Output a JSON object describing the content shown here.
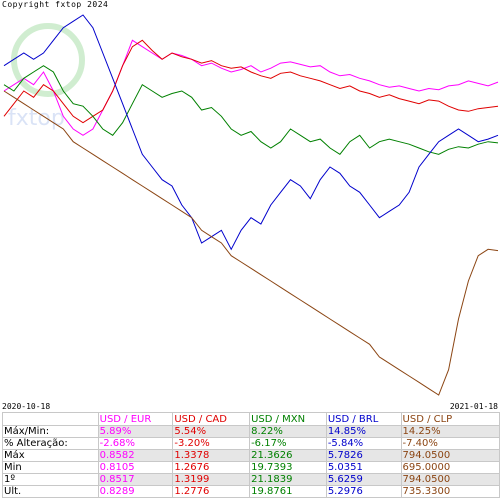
{
  "copyright": "Copyright fxtop 2024",
  "watermark": "fxtop",
  "chart_data": {
    "type": "line",
    "x_start_label": "2020-10-18",
    "x_end_label": "2021-01-18",
    "series": [
      {
        "name": "USD / EUR",
        "color": "#ff00ff",
        "values": [
          0.6,
          0.55,
          0.5,
          0.55,
          0.45,
          0.6,
          0.8,
          0.9,
          0.95,
          0.9,
          0.75,
          0.6,
          0.4,
          0.2,
          0.25,
          0.3,
          0.35,
          0.3,
          0.32,
          0.35,
          0.4,
          0.38,
          0.42,
          0.45,
          0.43,
          0.4,
          0.45,
          0.42,
          0.38,
          0.37,
          0.39,
          0.41,
          0.4,
          0.45,
          0.48,
          0.47,
          0.5,
          0.52,
          0.55,
          0.57,
          0.56,
          0.58,
          0.6,
          0.58,
          0.59,
          0.56,
          0.55,
          0.52,
          0.54,
          0.56,
          0.53
        ]
      },
      {
        "name": "USD / CAD",
        "color": "#e00000",
        "values": [
          0.8,
          0.7,
          0.6,
          0.65,
          0.55,
          0.6,
          0.7,
          0.8,
          0.85,
          0.8,
          0.75,
          0.6,
          0.4,
          0.25,
          0.2,
          0.28,
          0.35,
          0.3,
          0.33,
          0.35,
          0.38,
          0.36,
          0.4,
          0.42,
          0.41,
          0.45,
          0.48,
          0.5,
          0.46,
          0.45,
          0.48,
          0.5,
          0.52,
          0.55,
          0.58,
          0.56,
          0.6,
          0.62,
          0.65,
          0.63,
          0.66,
          0.68,
          0.7,
          0.67,
          0.68,
          0.72,
          0.75,
          0.76,
          0.74,
          0.73,
          0.72
        ]
      },
      {
        "name": "USD / MXN",
        "color": "#008000",
        "values": [
          0.55,
          0.6,
          0.5,
          0.45,
          0.4,
          0.45,
          0.6,
          0.7,
          0.72,
          0.8,
          0.9,
          0.95,
          0.85,
          0.7,
          0.55,
          0.6,
          0.65,
          0.62,
          0.6,
          0.65,
          0.75,
          0.73,
          0.8,
          0.9,
          0.95,
          0.92,
          1.0,
          1.05,
          1.0,
          0.9,
          0.95,
          1.0,
          0.98,
          1.05,
          1.1,
          1.0,
          0.95,
          1.05,
          1.0,
          0.98,
          1.0,
          1.02,
          1.05,
          1.08,
          1.1,
          1.06,
          1.04,
          1.05,
          1.02,
          1.0,
          1.01
        ]
      },
      {
        "name": "USD / BRL",
        "color": "#0000cc",
        "values": [
          0.4,
          0.35,
          0.3,
          0.35,
          0.3,
          0.2,
          0.1,
          0.05,
          0.0,
          0.1,
          0.3,
          0.5,
          0.7,
          0.9,
          1.1,
          1.2,
          1.3,
          1.35,
          1.5,
          1.6,
          1.8,
          1.75,
          1.7,
          1.85,
          1.7,
          1.6,
          1.65,
          1.5,
          1.4,
          1.3,
          1.35,
          1.45,
          1.3,
          1.2,
          1.25,
          1.35,
          1.4,
          1.5,
          1.6,
          1.55,
          1.5,
          1.4,
          1.2,
          1.1,
          1.0,
          0.95,
          0.9,
          0.95,
          1.0,
          0.98,
          0.95
        ]
      },
      {
        "name": "USD / CLP",
        "color": "#8b4513",
        "values": [
          0.6,
          0.65,
          0.7,
          0.75,
          0.8,
          0.85,
          0.9,
          1.0,
          1.05,
          1.1,
          1.15,
          1.2,
          1.25,
          1.3,
          1.35,
          1.4,
          1.45,
          1.5,
          1.55,
          1.6,
          1.7,
          1.75,
          1.8,
          1.9,
          1.95,
          2.0,
          2.05,
          2.1,
          2.15,
          2.2,
          2.25,
          2.3,
          2.35,
          2.4,
          2.45,
          2.5,
          2.55,
          2.6,
          2.7,
          2.75,
          2.8,
          2.85,
          2.9,
          2.95,
          3.0,
          2.8,
          2.4,
          2.1,
          1.9,
          1.85,
          1.86
        ]
      }
    ]
  },
  "table": {
    "headers": [
      "",
      "USD / EUR",
      "USD / CAD",
      "USD / MXN",
      "USD / BRL",
      "USD / CLP"
    ],
    "header_colors": [
      "#000000",
      "#ff00ff",
      "#e00000",
      "#008000",
      "#0000cc",
      "#8b4513"
    ],
    "rows": [
      [
        "Máx/Min:",
        "5.89%",
        "5.54%",
        "8.22%",
        "14.85%",
        "14.25%"
      ],
      [
        "% Alteração:",
        "-2.68%",
        "-3.20%",
        "-6.17%",
        "-5.84%",
        "-7.40%"
      ],
      [
        "Máx",
        "0.8582",
        "1.3378",
        "21.3626",
        "5.7826",
        "794.0500"
      ],
      [
        "Min",
        "0.8105",
        "1.2676",
        "19.7393",
        "5.0351",
        "695.0000"
      ],
      [
        "1º",
        "0.8517",
        "1.3199",
        "21.1839",
        "5.6259",
        "794.0500"
      ],
      [
        "Ult.",
        "0.8289",
        "1.2776",
        "19.8761",
        "5.2976",
        "735.3300"
      ]
    ]
  }
}
